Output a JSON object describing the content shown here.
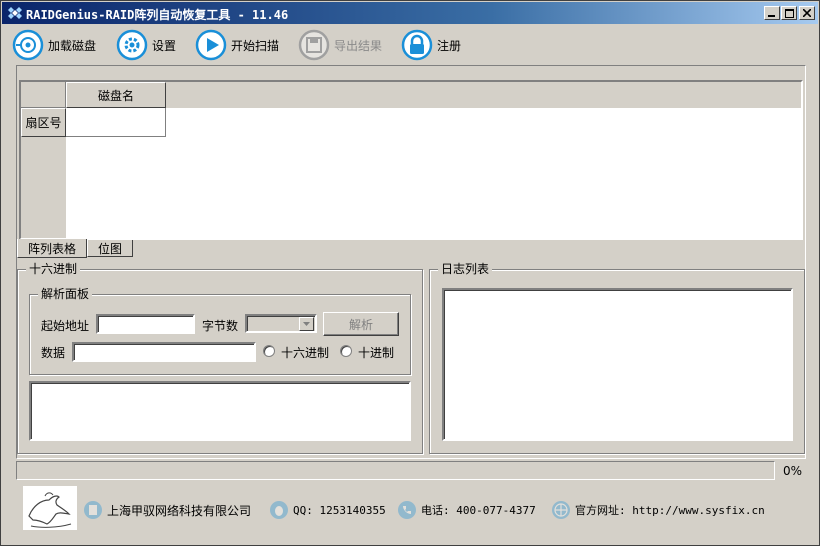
{
  "window": {
    "title": "RAIDGenius-RAID阵列自动恢复工具 - 11.46"
  },
  "toolbar": {
    "items": [
      {
        "label": "加载磁盘",
        "icon": "disk-load-icon",
        "enabled": true
      },
      {
        "label": "设置",
        "icon": "gear-icon",
        "enabled": true
      },
      {
        "label": "开始扫描",
        "icon": "play-icon",
        "enabled": true
      },
      {
        "label": "导出结果",
        "icon": "floppy-disk-icon",
        "enabled": false
      },
      {
        "label": "注册",
        "icon": "lock-icon",
        "enabled": true
      }
    ]
  },
  "grid": {
    "column_header": "磁盘名",
    "row_header": "扇区号"
  },
  "tabs": [
    {
      "label": "阵列表格",
      "active": true
    },
    {
      "label": "位图",
      "active": false
    }
  ],
  "hex_panel": {
    "title": "十六进制",
    "parse_panel": {
      "title": "解析面板",
      "start_address_label": "起始地址",
      "start_address_value": "",
      "byte_count_label": "字节数",
      "byte_count_value": "",
      "parse_button": "解析",
      "data_label": "数据",
      "data_value": "",
      "radio_hex": "十六进制",
      "radio_dec": "十进制"
    }
  },
  "log_panel": {
    "title": "日志列表"
  },
  "progress": {
    "percent": 0,
    "text": "0%"
  },
  "footer": {
    "company": "上海甲驭网络科技有限公司",
    "qq": "QQ: 1253140355",
    "phone": "电话: 400-077-4377",
    "website": "官方网址: http://www.sysfix.cn"
  },
  "colors": {
    "accent_blue": "#1a8fd8",
    "titlebar": "#0a246a",
    "face": "#d4d0c8"
  }
}
